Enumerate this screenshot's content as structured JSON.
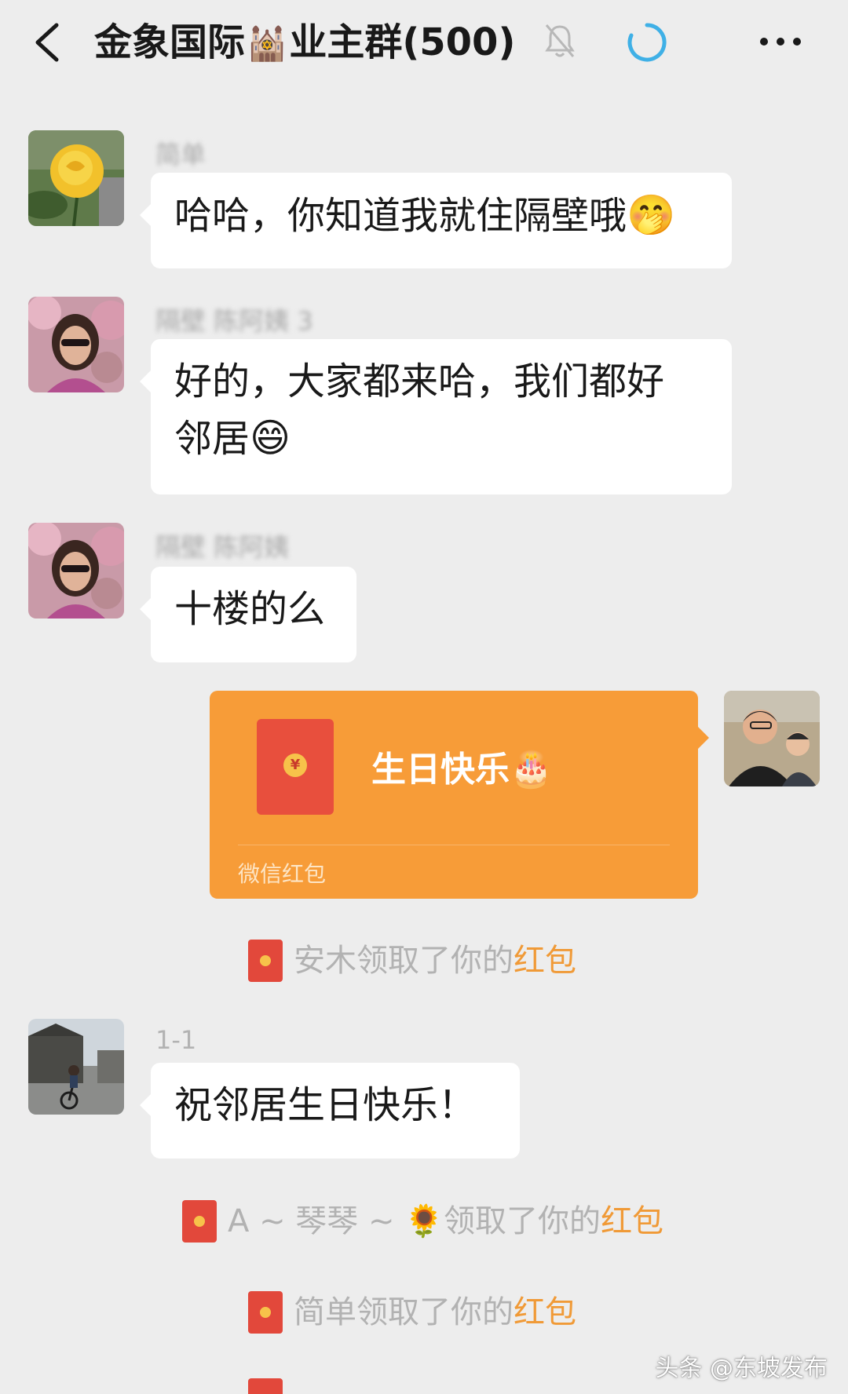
{
  "header": {
    "title_prefix": "金象国际",
    "title_emoji": "🕍",
    "title_suffix": "业主群(500)",
    "icons": {
      "back": "back-icon",
      "mute": "bell-off-icon",
      "loading": "loading-icon",
      "more": "more-icon"
    }
  },
  "messages": [
    {
      "sender": "简单",
      "text": "哈哈，你知道我就住隔壁哦",
      "emoji": "🤭"
    },
    {
      "sender": "隔壁 陈阿姨 3",
      "text_line1": "好的，大家都来哈，我们都好",
      "text_line2": "邻居",
      "emoji": "😄"
    },
    {
      "sender": "隔壁 陈阿姨",
      "text": "十楼的么"
    },
    {
      "red_packet": {
        "title": "生日快乐",
        "emoji": "🎂",
        "label": "微信红包",
        "color": "#f79c38"
      }
    },
    {
      "sender": "1-1",
      "text": "祝邻居生日快乐！"
    }
  ],
  "notices": [
    {
      "prefix": "安木领取了你的",
      "highlight": "红包"
    },
    {
      "prefix": "A ~ 琴琴 ~ 🌻领取了你的",
      "highlight": "红包"
    },
    {
      "prefix": "简单领取了你的",
      "highlight": "红包"
    }
  ],
  "watermark": "头条 @东坡发布",
  "colors": {
    "background": "#ededed",
    "bubble": "#ffffff",
    "red_packet": "#f79c38",
    "notice_highlight": "#f09a37",
    "loading_accent": "#3fb0e6"
  }
}
